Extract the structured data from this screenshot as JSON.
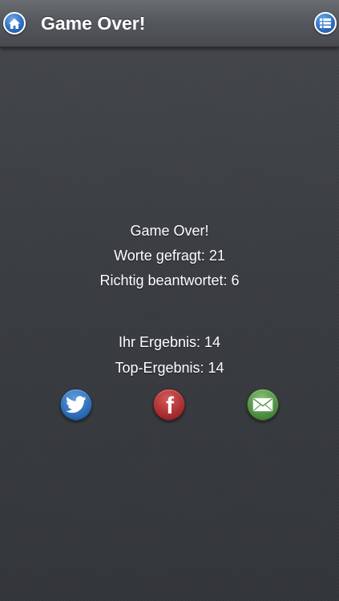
{
  "header": {
    "title": "Game Over!",
    "home_icon": "home-icon",
    "menu_icon": "list-icon"
  },
  "result": {
    "heading": "Game Over!",
    "words_asked": "Worte gefragt: 21",
    "answered_correctly": "Richtig beantwortet: 6",
    "your_score": "Ihr Ergebnis: 14",
    "top_score": "Top-Ergebnis: 14"
  },
  "share": {
    "twitter_icon": "twitter-bird-icon",
    "facebook_icon": "facebook-icon",
    "mail_icon": "envelope-icon",
    "facebook_glyph": "f"
  },
  "colors": {
    "background": "#3b3e42",
    "navbar": "#55585d",
    "accent_blue": "#2f6fc1",
    "twitter": "#2f6db8",
    "facebook": "#a92f32",
    "mail": "#4f8f42",
    "text": "#ffffff"
  }
}
